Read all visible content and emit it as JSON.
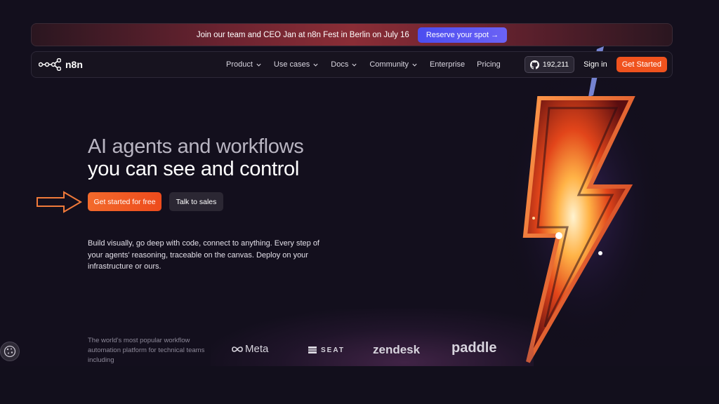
{
  "banner": {
    "text": "Join our team and CEO Jan at n8n Fest in Berlin on July 16",
    "button": "Reserve your spot →"
  },
  "nav": {
    "logo": "n8n",
    "links": [
      {
        "label": "Product",
        "dropdown": true
      },
      {
        "label": "Use cases",
        "dropdown": true
      },
      {
        "label": "Docs",
        "dropdown": true
      },
      {
        "label": "Community",
        "dropdown": true
      },
      {
        "label": "Enterprise",
        "dropdown": false
      },
      {
        "label": "Pricing",
        "dropdown": false
      }
    ],
    "github_stars": "192,211",
    "sign_in": "Sign in",
    "get_started": "Get Started"
  },
  "hero": {
    "headline_line1": "AI agents and workflows",
    "headline_line2": "you can see and control",
    "cta_primary": "Get started for free",
    "cta_secondary": "Talk to sales",
    "description": "Build visually, go deep with code, connect to anything. Every step of your agents' reasoning, traceable on the canvas. Deploy on your infrastructure or ours."
  },
  "trust": {
    "text": "The world's most popular workflow automation platform for technical teams including",
    "logos": [
      "Meta",
      "SEAT",
      "zendesk",
      "paddle"
    ]
  },
  "colors": {
    "accent": "#f0531e",
    "banner_button": "#5a57f2",
    "background": "#130f1d"
  },
  "icons": [
    "n8n-logo-icon",
    "chevron-down-icon",
    "github-icon",
    "arrow-right-icon",
    "cookie-icon",
    "lightning-bolt-icon"
  ]
}
